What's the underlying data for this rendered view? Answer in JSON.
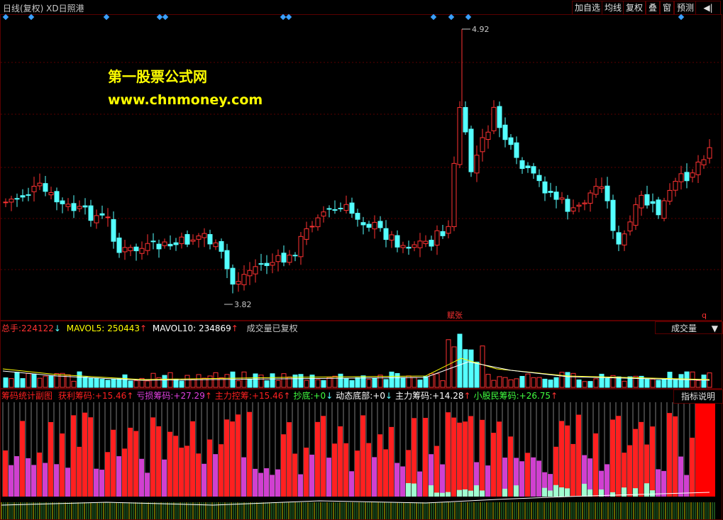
{
  "header": {
    "title": "日线(复权) XD日照港",
    "buttons": [
      "加自选",
      "均线",
      "复权",
      "叠",
      "窗",
      "预测"
    ],
    "nav_icon": "arrow-icon"
  },
  "watermark": {
    "line1": "第一股票公式网",
    "line2": "www.chnmoney.com"
  },
  "price_panel": {
    "high_label": "4.92",
    "low_label": "3.82",
    "badge_text": "赋张",
    "badge_right": "q"
  },
  "volume_panel": {
    "total_label": "总手:",
    "total_value": "224122",
    "total_arrow": "↓",
    "mavol5_label": "MAVOL5:",
    "mavol5_value": "250443",
    "mavol5_arrow": "↑",
    "mavol10_label": "MAVOL10:",
    "mavol10_value": "234869",
    "mavol10_arrow": "↑",
    "note": "成交量已复权",
    "selector": "成交量",
    "selector_arrow": "▼"
  },
  "indicator_panel": {
    "name": "筹码统计副图",
    "items": [
      {
        "label": "获利筹码:",
        "value": "+15.46",
        "arrow": "↑",
        "color": "#ff2020"
      },
      {
        "label": "亏损筹码:",
        "value": "+27.29",
        "arrow": "↑",
        "color": "#e040e0"
      },
      {
        "label": "主力控筹:",
        "value": "+15.46",
        "arrow": "↑",
        "color": "#ff2020"
      },
      {
        "label": "抄底:",
        "value": "+0",
        "arrow": "↓",
        "color": "#40ff40"
      },
      {
        "label": "动态底部:",
        "value": "+0",
        "arrow": "↓",
        "color": "#ffffff"
      },
      {
        "label": "主力筹码:",
        "value": "+14.28",
        "arrow": "↑",
        "color": "#ffffff"
      },
      {
        "label": "小股民筹码:",
        "value": "+26.75",
        "arrow": "↑",
        "color": "#40ff40"
      }
    ],
    "explain_button": "指标说明"
  },
  "colors": {
    "up": "#ff3232",
    "down": "#54ffff",
    "grid": "#5a0000",
    "profit": "#ff2020",
    "loss": "#d040d0",
    "retail": "#a0ffd0"
  }
}
